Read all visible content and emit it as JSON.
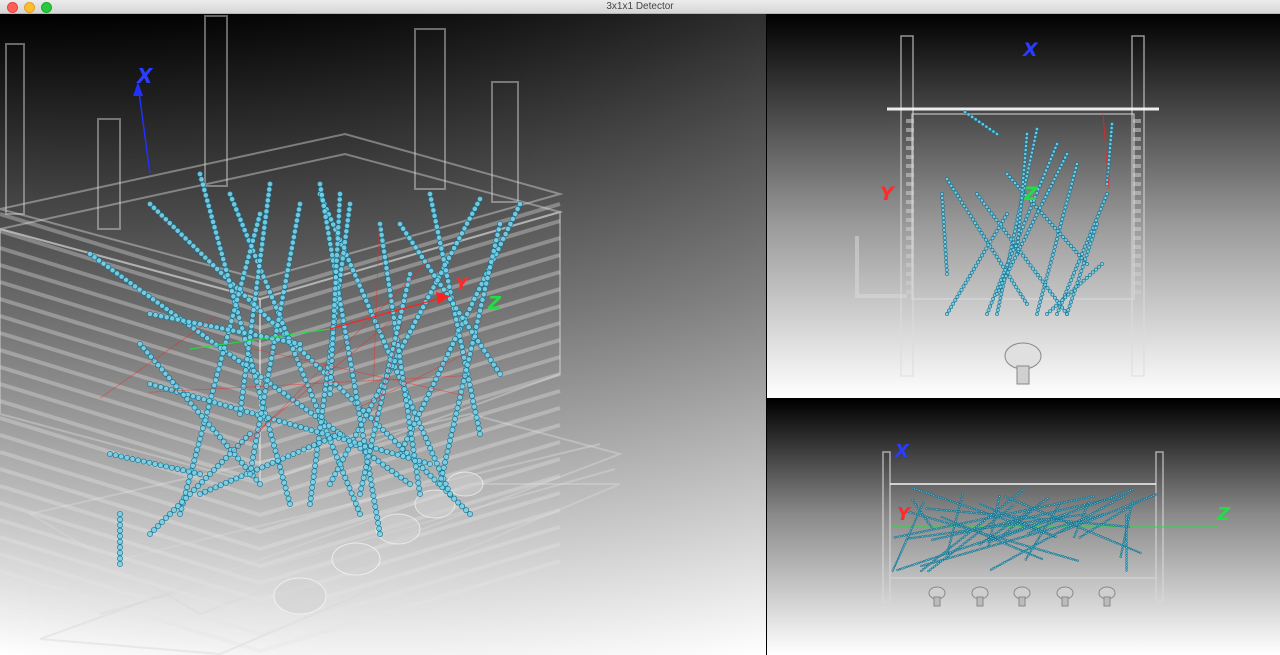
{
  "window": {
    "title": "3x1x1 Detector"
  },
  "colors": {
    "track": "#2fa8c8",
    "track_light": "#7fd3ea",
    "x_axis": "#2030ff",
    "y_axis": "#ff2020",
    "z_axis": "#20e040"
  },
  "views": {
    "perspective": {
      "axes": {
        "x": "X",
        "y": "Y",
        "z": "Z"
      }
    },
    "top": {
      "axes": {
        "x": "X",
        "y": "Y",
        "z": "Z"
      }
    },
    "side": {
      "axes": {
        "x": "X",
        "y": "Y",
        "z": "Z"
      }
    }
  }
}
